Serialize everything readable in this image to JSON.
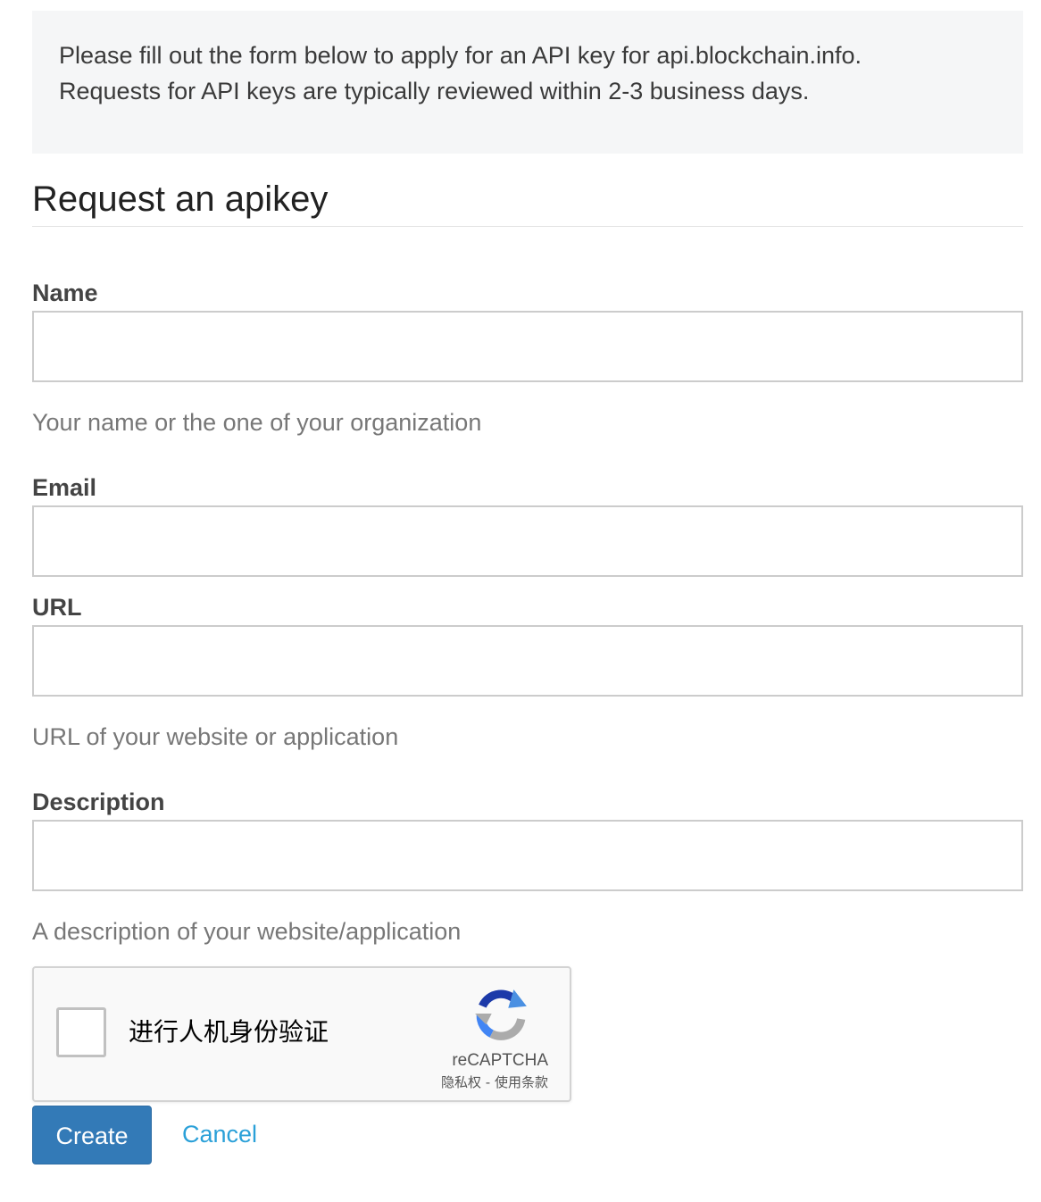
{
  "notice": {
    "line1": "Please fill out the form below to apply for an API key for api.blockchain.info.",
    "line2": "Requests for API keys are typically reviewed within 2-3 business days."
  },
  "form": {
    "title": "Request an apikey",
    "name": {
      "label": "Name",
      "value": "",
      "help": "Your name or the one of your organization"
    },
    "email": {
      "label": "Email",
      "value": ""
    },
    "url": {
      "label": "URL",
      "value": "",
      "help": "URL of your website or application"
    },
    "description": {
      "label": "Description",
      "value": "",
      "help": "A description of your website/application"
    }
  },
  "captcha": {
    "checkbox_text": "进行人机身份验证",
    "brand": "reCAPTCHA",
    "privacy": "隐私权",
    "separator": " - ",
    "terms": "使用条款",
    "icon": "recaptcha-logo-icon",
    "checked": false
  },
  "actions": {
    "create_label": "Create",
    "cancel_label": "Cancel"
  },
  "colors": {
    "primary": "#337ab7",
    "link": "#2aa0d8",
    "notice_bg": "#f5f6f7"
  }
}
